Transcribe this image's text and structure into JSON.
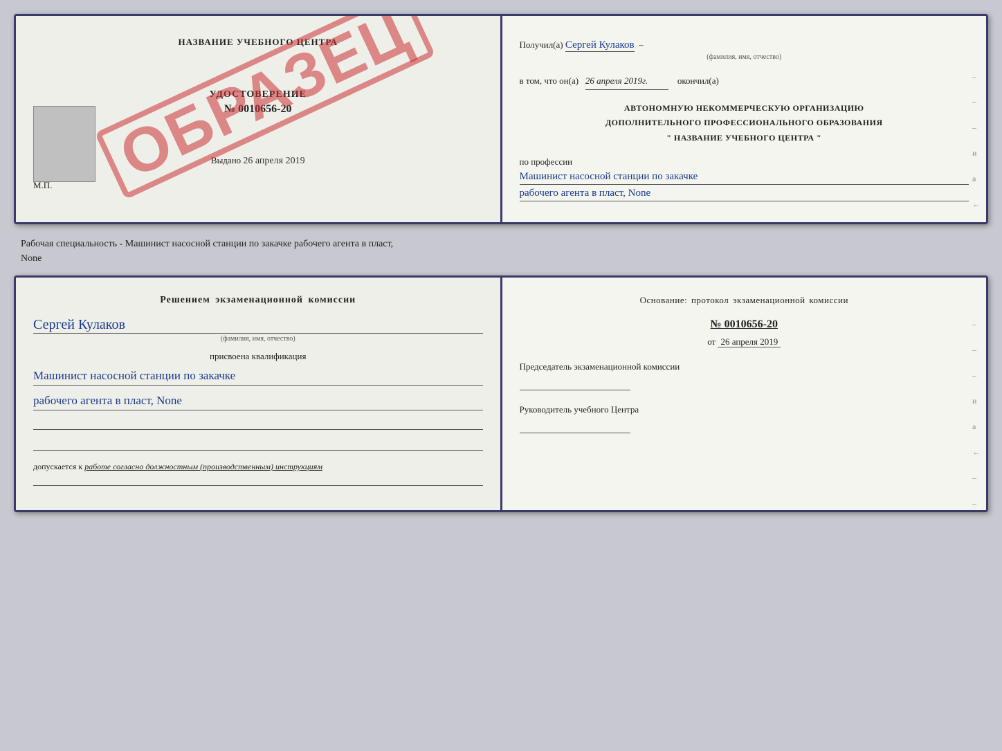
{
  "top_doc": {
    "left": {
      "header": "НАЗВАНИЕ УЧЕБНОГО ЦЕНТРА",
      "stamp": "ОБРАЗЕЦ",
      "udostoverenie_title": "УДОСТОВЕРЕНИЕ",
      "udostoverenie_number": "№ 0010656-20",
      "vydano_label": "Выдано",
      "vydano_date": "26 апреля 2019",
      "mp_label": "М.П."
    },
    "right": {
      "poluchil_label": "Получил(a)",
      "poluchil_name": "Сергей Кулаков",
      "familiya_label": "(фамилия, имя, отчество)",
      "vtom_label": "в том, что он(a)",
      "vtom_date": "26 апреля 2019г.",
      "okonchil_label": "окончил(а)",
      "org_line1": "АВТОНОМНУЮ НЕКОММЕРЧЕСКУЮ ОРГАНИЗАЦИЮ",
      "org_line2": "ДОПОЛНИТЕЛЬНОГО ПРОФЕССИОНАЛЬНОГО ОБРАЗОВАНИЯ",
      "org_line3": "\"  НАЗВАНИЕ УЧЕБНОГО ЦЕНТРА  \"",
      "po_professii_label": "по профессии",
      "profession_line1": "Машинист насосной станции по закачке",
      "profession_line2": "рабочего агента в пласт, None",
      "dashes": [
        "-",
        "-",
        "-",
        "и",
        "а",
        "←",
        "-",
        "-",
        "-"
      ]
    }
  },
  "separator": {
    "text": "Рабочая специальность - Машинист насосной станции по закачке рабочего агента в пласт,",
    "text2": "None"
  },
  "bottom_doc": {
    "left": {
      "resheniem_label": "Решением  экзаменационной  комиссии",
      "name": "Сергей Кулаков",
      "familiya_label": "(фамилия, имя, отчество)",
      "prisvoena_label": "присвоена квалификация",
      "qualification_line1": "Машинист насосной станции по закачке",
      "qualification_line2": "рабочего агента в пласт, None",
      "dopuskaetsya_label": "допускается к",
      "dopuskaetsya_text": "работе согласно должностным (производственным) инструкциям"
    },
    "right": {
      "osnovaniye_label": "Основание:  протокол  экзаменационной  комиссии",
      "protocol_number": "№  0010656-20",
      "ot_label": "от",
      "ot_date": "26 апреля 2019",
      "predsedatel_label": "Председатель экзаменационной комиссии",
      "rukovoditel_label": "Руководитель учебного Центра",
      "dashes": [
        "-",
        "-",
        "-",
        "и",
        "а",
        "←",
        "-",
        "-",
        "-",
        "-"
      ]
    }
  }
}
